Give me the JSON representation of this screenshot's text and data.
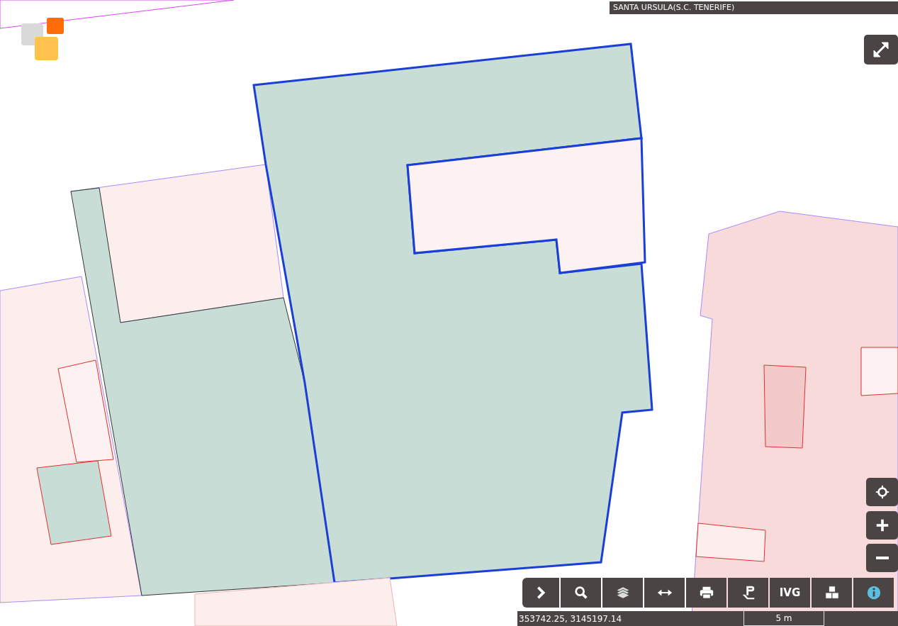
{
  "location_bar": {
    "title": "SANTA URSULA(S.C. TENERIFE)"
  },
  "toolbar": [
    {
      "kind": "chevron"
    },
    {
      "kind": "search"
    },
    {
      "kind": "layers"
    },
    {
      "kind": "measure"
    },
    {
      "kind": "print"
    },
    {
      "kind": "parcel"
    },
    {
      "kind": "text",
      "label": "IVG"
    },
    {
      "kind": "cubes"
    },
    {
      "kind": "info"
    }
  ],
  "map_controls": [
    {
      "kind": "locate"
    },
    {
      "kind": "zoom-in"
    },
    {
      "kind": "zoom-out"
    }
  ],
  "status_bar": {
    "coordinates": "353742.25, 3145197.14",
    "scale": "5 m"
  }
}
